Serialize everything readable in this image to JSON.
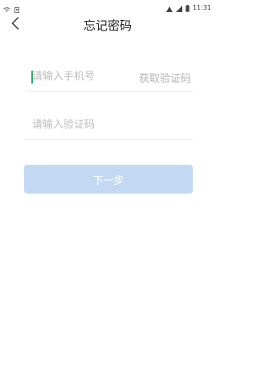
{
  "status_bar": {
    "time": "11:31",
    "icons": [
      "wifi-icon",
      "notification-icon",
      "signal-icon",
      "battery-icon"
    ]
  },
  "nav": {
    "title": "忘记密码",
    "back_icon": "chevron-left-icon"
  },
  "form": {
    "phone_placeholder": "请输入手机号",
    "get_code_label": "获取验证码",
    "code_placeholder": "请输入验证码",
    "next_label": "下一步"
  },
  "colors": {
    "cursor": "#2aa86a",
    "button_bg": "#c3d9f3",
    "placeholder": "#bdbdbd"
  }
}
